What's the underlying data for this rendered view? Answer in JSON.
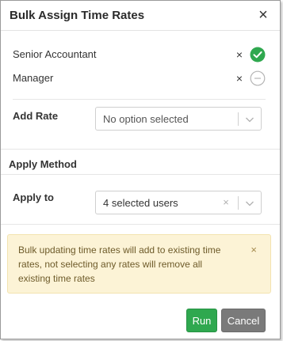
{
  "dialog": {
    "title": "Bulk Assign Time Rates",
    "close_icon": "×"
  },
  "rates": [
    {
      "label": "Senior Accountant",
      "remove_icon": "×",
      "status": "selected"
    },
    {
      "label": "Manager",
      "remove_icon": "×",
      "status": "unselected"
    }
  ],
  "add_rate": {
    "label": "Add Rate",
    "placeholder": "No option selected"
  },
  "apply_method": {
    "heading": "Apply Method",
    "apply_to_label": "Apply to",
    "apply_to_value": "4 selected users",
    "clear_icon": "×"
  },
  "alert": {
    "message": "Bulk updating time rates will add to existing time rates, not selecting any rates will remove all existing time rates",
    "close_icon": "×"
  },
  "buttons": {
    "run": "Run",
    "cancel": "Cancel"
  },
  "colors": {
    "success": "#2fa84f",
    "cancel": "#7a7a7a",
    "alert_bg": "#fcf3d6"
  }
}
